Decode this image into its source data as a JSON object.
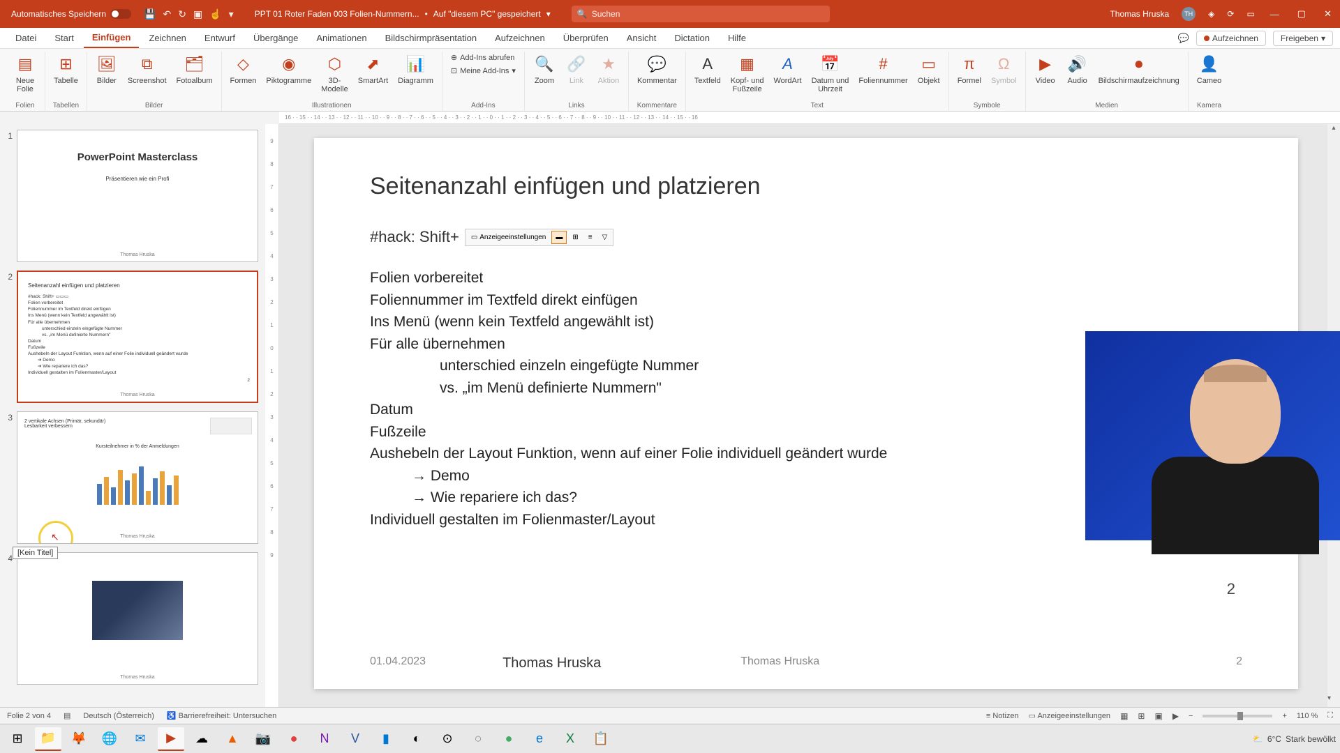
{
  "titlebar": {
    "autosave": "Automatisches Speichern",
    "docname": "PPT 01 Roter Faden 003 Folien-Nummern...",
    "savedloc": "Auf \"diesem PC\" gespeichert",
    "search": "Suchen",
    "user": "Thomas Hruska",
    "user_initials": "TH"
  },
  "tabs": {
    "file": "Datei",
    "start": "Start",
    "insert": "Einfügen",
    "draw": "Zeichnen",
    "design": "Entwurf",
    "transitions": "Übergänge",
    "animations": "Animationen",
    "slideshow": "Bildschirmpräsentation",
    "record": "Aufzeichnen",
    "review": "Überprüfen",
    "view": "Ansicht",
    "dictation": "Dictation",
    "help": "Hilfe",
    "aufzeichnen_btn": "Aufzeichnen",
    "share": "Freigeben"
  },
  "ribbon": {
    "neue_folie": "Neue\nFolie",
    "folien": "Folien",
    "tabelle": "Tabelle",
    "tabellen": "Tabellen",
    "bilder": "Bilder",
    "screenshot": "Screenshot",
    "fotoalbum": "Fotoalbum",
    "bilder_grp": "Bilder",
    "formen": "Formen",
    "piktogramme": "Piktogramme",
    "modelle": "3D-\nModelle",
    "smartart": "SmartArt",
    "diagramm": "Diagramm",
    "illustrationen": "Illustrationen",
    "addins_abrufen": "Add-Ins abrufen",
    "meine_addins": "Meine Add-Ins",
    "addins": "Add-Ins",
    "zoom": "Zoom",
    "link": "Link",
    "aktion": "Aktion",
    "links": "Links",
    "kommentar": "Kommentar",
    "kommentare": "Kommentare",
    "textfeld": "Textfeld",
    "kopf": "Kopf- und\nFußzeile",
    "wordart": "WordArt",
    "datum": "Datum und\nUhrzeit",
    "foliennr": "Foliennummer",
    "objekt": "Objekt",
    "text": "Text",
    "formel": "Formel",
    "symbol": "Symbol",
    "symbole": "Symbole",
    "video": "Video",
    "audio": "Audio",
    "bildschirm": "Bildschirmaufzeichnung",
    "medien": "Medien",
    "cameo": "Cameo",
    "kamera": "Kamera"
  },
  "ruler": "16 · · 15 · · 14 · · 13 · · 12 · · 11 · · 10 · · 9 · · 8 · · 7 · · 6 · · 5 · · 4 · · 3 · · 2 · · 1 · · 0 · · 1 · · 2 · · 3 · · 4 · · 5 · · 6 · · 7 · · 8 · · 9 · · 10 · · 11 · · 12 · · 13 · · 14 · · 15 · · 16",
  "thumbs": {
    "t1_title": "PowerPoint Masterclass",
    "t1_sub": "Präsentieren wie ein Profi",
    "t1_foot": "Thomas Hruska",
    "t2_title": "Seitenanzahl einfügen und platzieren",
    "t3_title": "2 vertikale Achsen (Primär, sekundär)\nLesbarkeit verbessern",
    "t3_sub": "Kursteilnehmer in % der Anmeldungen",
    "tooltip": "[Kein Titel]",
    "foot": "Thomas Hruska"
  },
  "slide": {
    "title": "Seitenanzahl einfügen und platzieren",
    "hack": "#hack: Shift+",
    "fit_label": "Anzeigeeinstellungen",
    "l1": "Folien vorbereitet",
    "l2": "Foliennummer im Textfeld direkt einfügen",
    "l3": "Ins Menü (wenn kein Textfeld angewählt ist)",
    "l4": "Für alle übernehmen",
    "l5": "unterschied  einzeln eingefügte Nummer",
    "l6": "vs. „im Menü definierte Nummern\"",
    "l7": "Datum",
    "l8": "Fußzeile",
    "l9": "Aushebeln der Layout Funktion, wenn auf einer Folie individuell geändert wurde",
    "l10": "→  Demo",
    "l11": "→  Wie repariere ich das?",
    "l12": "Individuell gestalten im Folienmaster/Layout",
    "pgnum": "2",
    "foot_date": "01.04.2023",
    "foot_name1": "Thomas Hruska",
    "foot_name2": "Thomas Hruska",
    "foot_pg": "2"
  },
  "status": {
    "slide_of": "Folie 2 von 4",
    "lang": "Deutsch (Österreich)",
    "access": "Barrierefreiheit: Untersuchen",
    "notizen": "Notizen",
    "anzeige": "Anzeigeeinstellungen",
    "zoom": "110 %"
  },
  "taskbar": {
    "weather_temp": "6°C",
    "weather_text": "Stark bewölkt"
  }
}
